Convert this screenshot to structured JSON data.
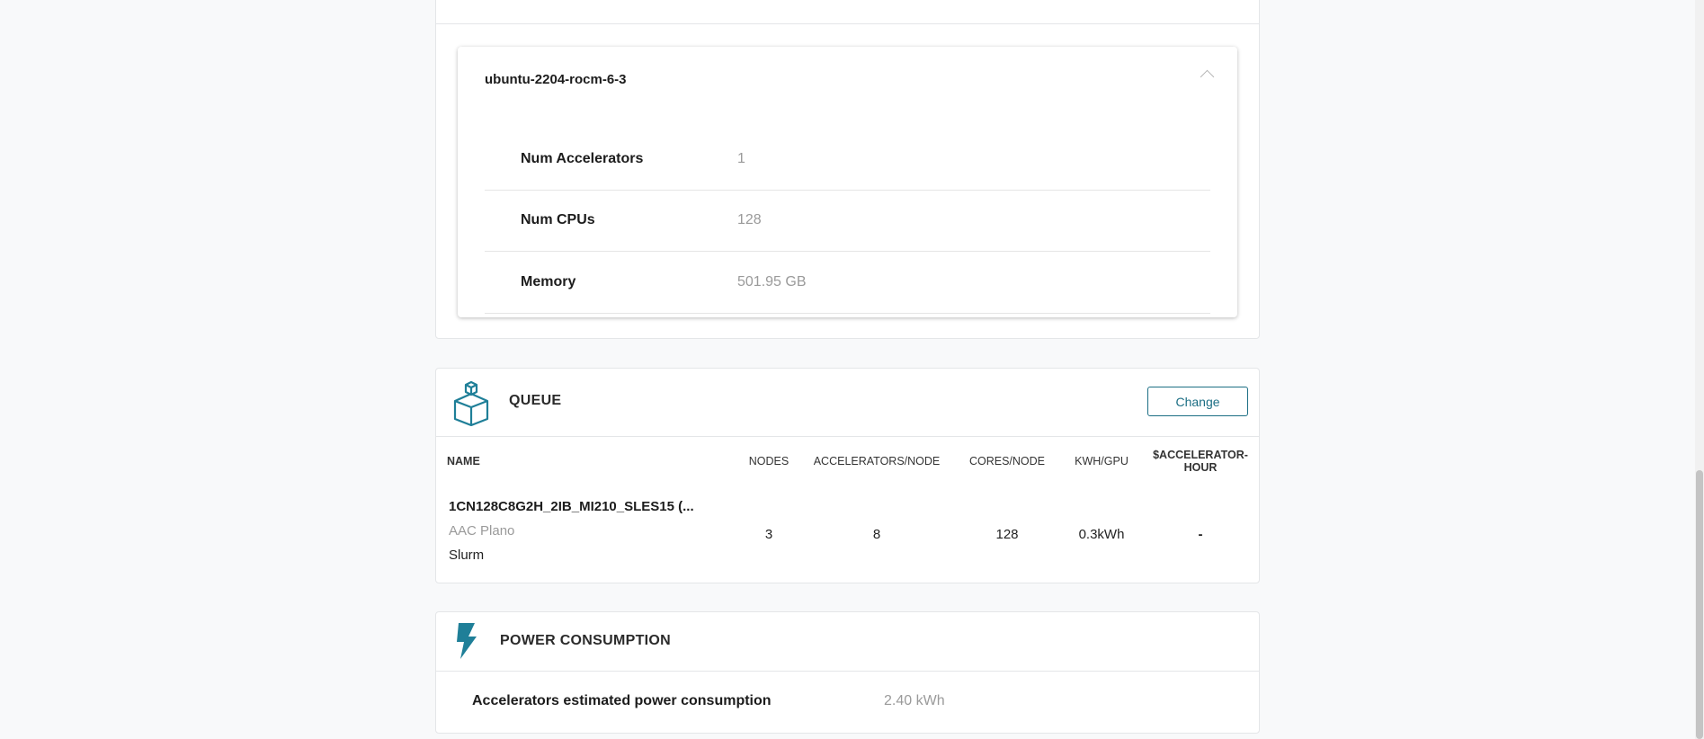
{
  "environment": {
    "title": "ubuntu-2204-rocm-6-3",
    "specs": [
      {
        "label": "Num Accelerators",
        "value": "1"
      },
      {
        "label": "Num CPUs",
        "value": "128"
      },
      {
        "label": "Memory",
        "value": "501.95 GB"
      }
    ]
  },
  "queue": {
    "title": "QUEUE",
    "change_label": "Change",
    "columns": {
      "name": "NAME",
      "nodes": "NODES",
      "accelerators_per_node": "ACCELERATORS/NODE",
      "cores_per_node": "CORES/NODE",
      "kwh_per_gpu": "KWH/GPU",
      "cost_line1": "$ACCELERATOR-",
      "cost_line2": "HOUR"
    },
    "row": {
      "name": "1CN128C8G2H_2IB_MI210_SLES15 (...",
      "site": "AAC Plano",
      "scheduler": "Slurm",
      "nodes": "3",
      "accelerators_per_node": "8",
      "cores_per_node": "128",
      "kwh_per_gpu": "0.3kWh",
      "cost": "-"
    }
  },
  "power": {
    "title": "POWER CONSUMPTION",
    "label": "Accelerators estimated power consumption",
    "value": "2.40 kWh"
  },
  "colors": {
    "accent": "#1b6e84",
    "icon": "#1f7f98"
  }
}
